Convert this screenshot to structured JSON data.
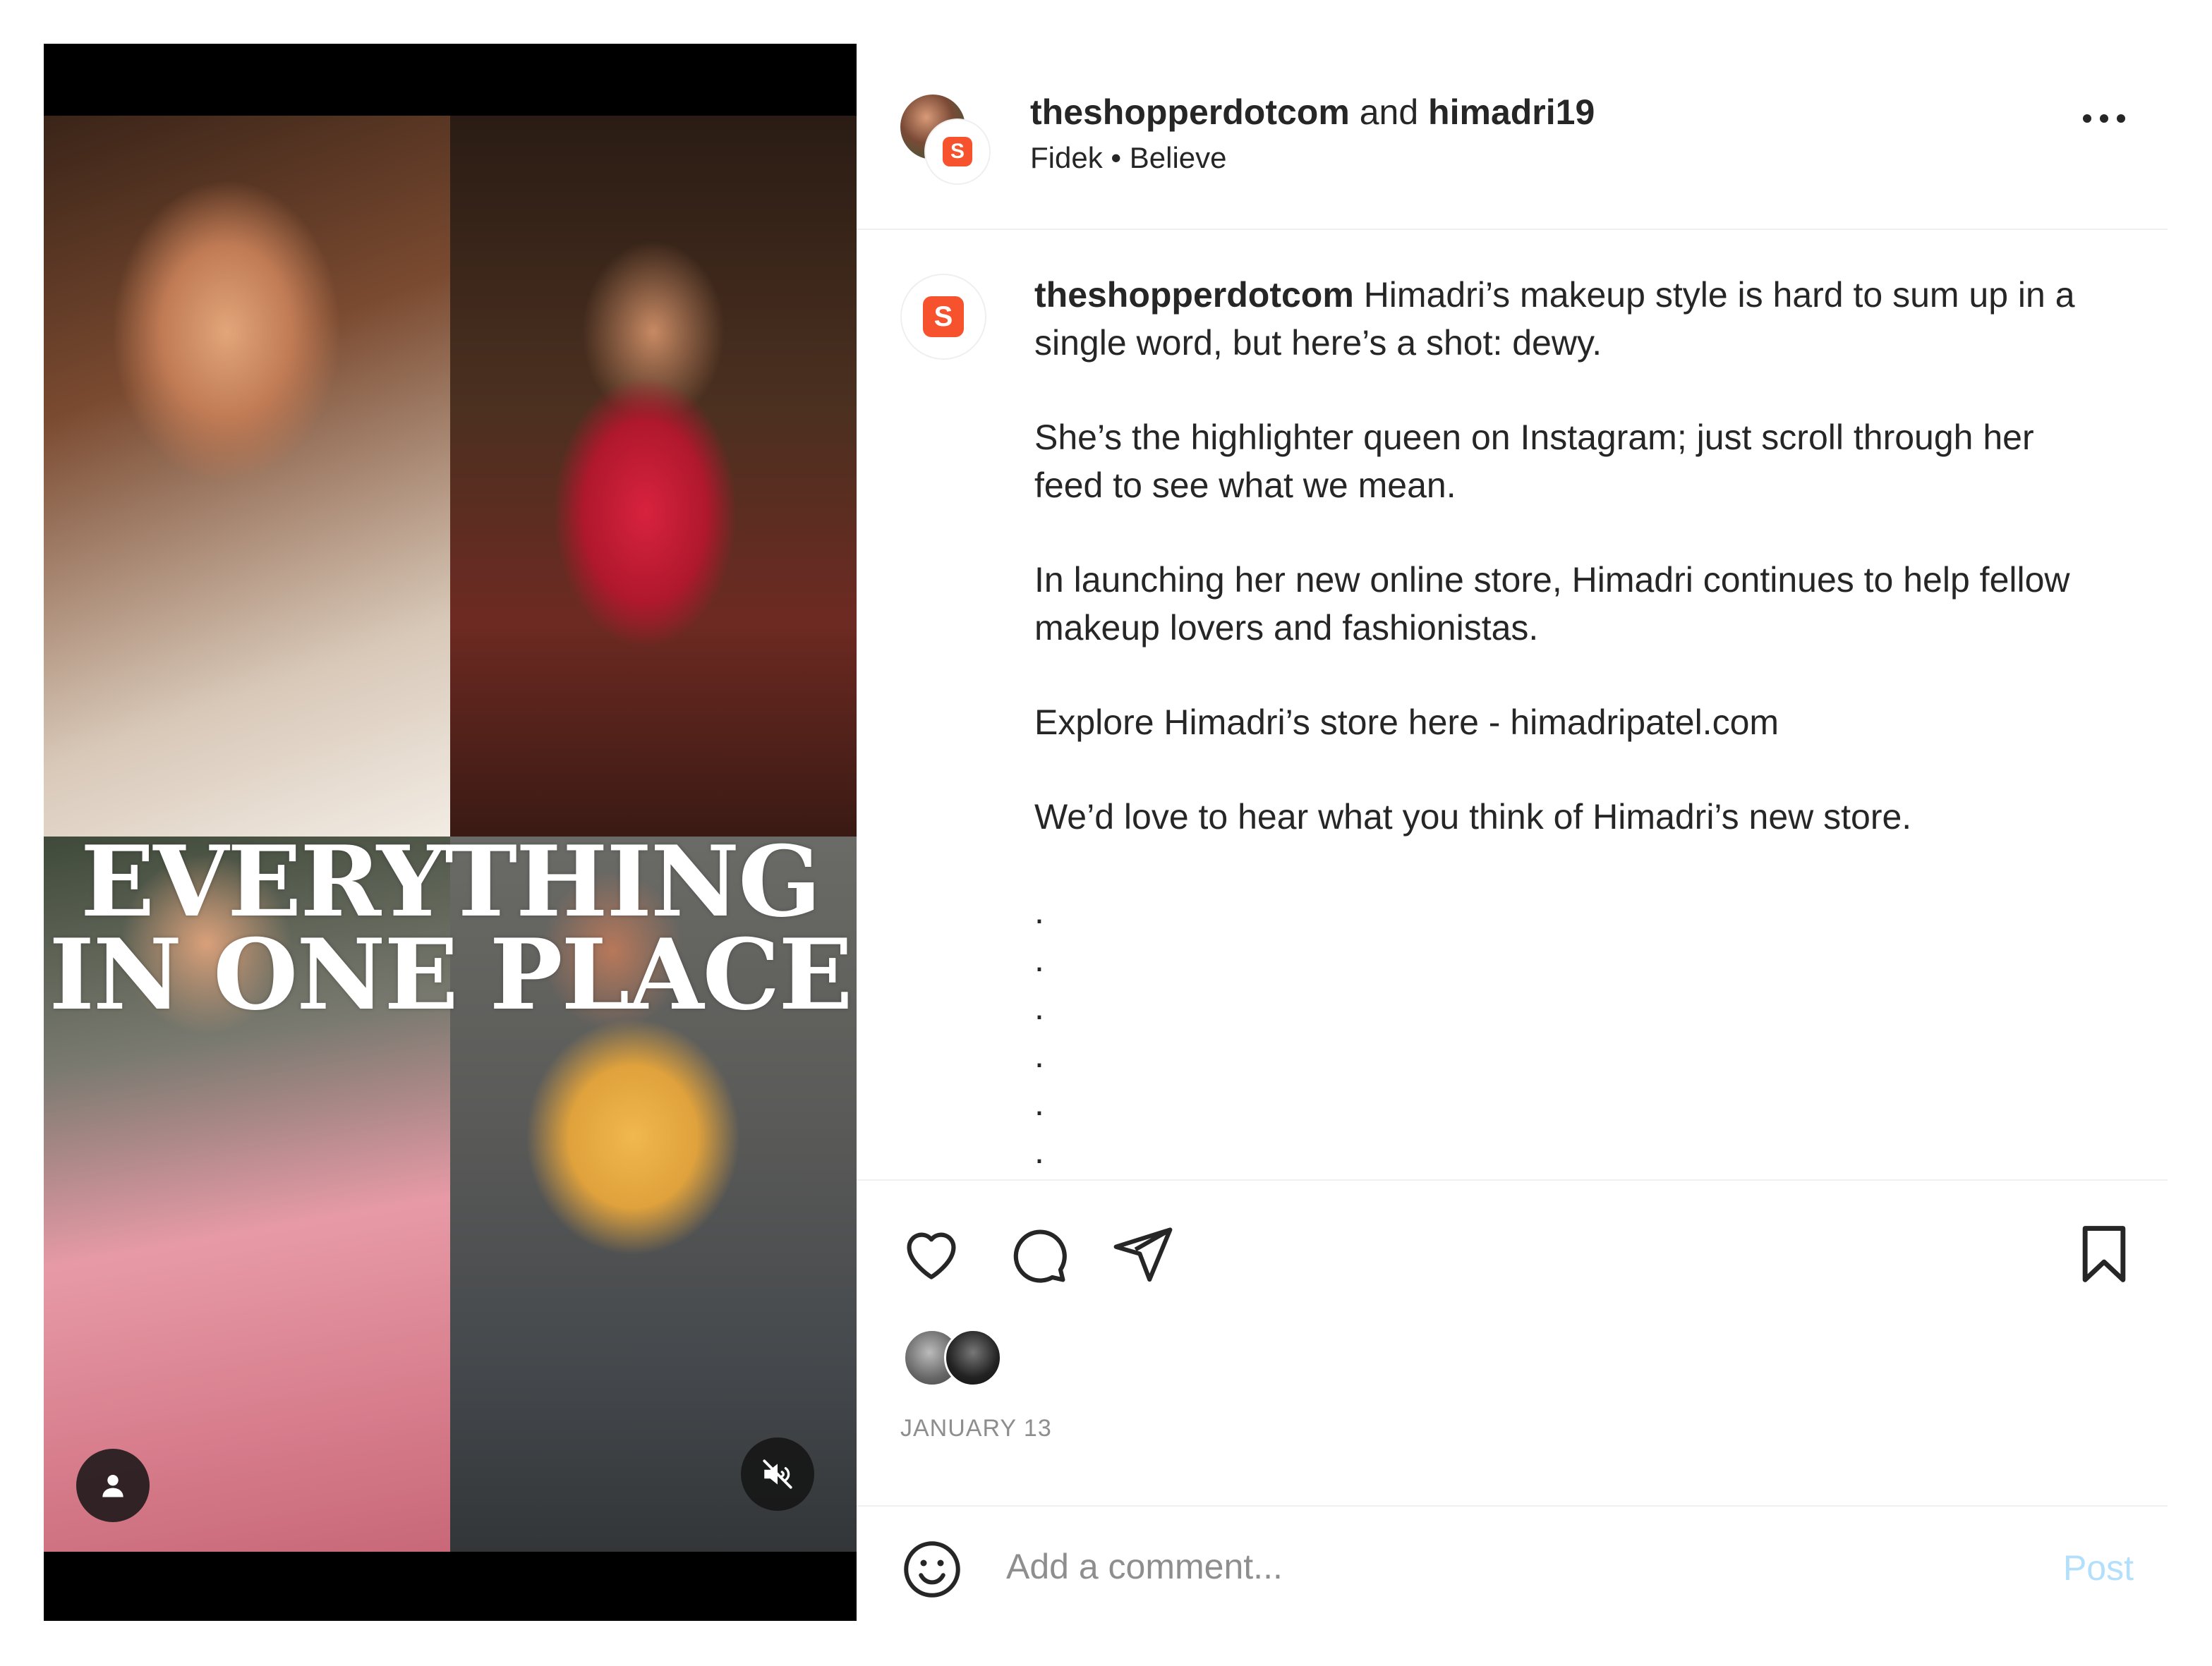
{
  "media": {
    "overlay_line1": "EVERYTHING",
    "overlay_line2": "IN ONE PLACE",
    "tag_people_icon": "user-icon",
    "mute_icon": "speaker-muted-icon"
  },
  "header": {
    "user1": "theshopperdotcom",
    "joiner": "and",
    "user2": "himadri19",
    "audio_artist": "Fidek",
    "separator": "•",
    "audio_track": "Believe",
    "more_icon": "more-horizontal-icon",
    "brand_logo_letter": "S"
  },
  "caption": {
    "username": "theshopperdotcom",
    "p1": "Himadri’s makeup style is hard to sum up in a single word, but here’s a shot: dewy.",
    "p2": "She’s the highlighter queen on Instagram; just scroll through her feed to see what we mean.",
    "p3": "In launching her new online store, Himadri continues to help fellow makeup lovers and fashionistas.",
    "p4": "Explore Himadri’s store here - himadripatel.com",
    "p5": "We’d love to hear what you think of Himadri’s new store.",
    "dots": [
      ".",
      ".",
      ".",
      ".",
      ".",
      "."
    ]
  },
  "actions": {
    "like_icon": "heart-icon",
    "comment_icon": "comment-icon",
    "share_icon": "paper-plane-icon",
    "save_icon": "bookmark-icon",
    "date": "JANUARY 13"
  },
  "comment": {
    "emoji_icon": "emoji-icon",
    "placeholder": "Add a comment...",
    "post_label": "Post"
  },
  "colors": {
    "brand": "#f5522d",
    "post_disabled": "#b2dffc",
    "secondary_text": "#8e8e8e"
  }
}
